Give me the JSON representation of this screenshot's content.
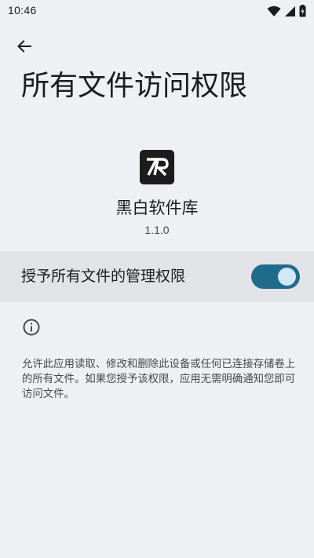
{
  "status_bar": {
    "time": "10:46",
    "icons": [
      "wifi-icon",
      "cell-signal-icon",
      "battery-charging-icon"
    ]
  },
  "header": {
    "back_icon": "arrow-back-icon",
    "title": "所有文件访问权限"
  },
  "app": {
    "icon": "app-logo-icon",
    "name": "黑白软件库",
    "version": "1.1.0"
  },
  "permission": {
    "label": "授予所有文件的管理权限",
    "enabled": true
  },
  "info": {
    "icon": "info-icon",
    "description": "允许此应用读取、修改和删除此设备或任何已连接存储卷上的所有文件。如果您授予该权限，应用无需明确通知您即可访问文件。"
  },
  "colors": {
    "background": "#eff0f4",
    "row_background": "#e2e3e7",
    "switch_track": "#1f6b8c",
    "switch_thumb": "#cfe9f6"
  }
}
